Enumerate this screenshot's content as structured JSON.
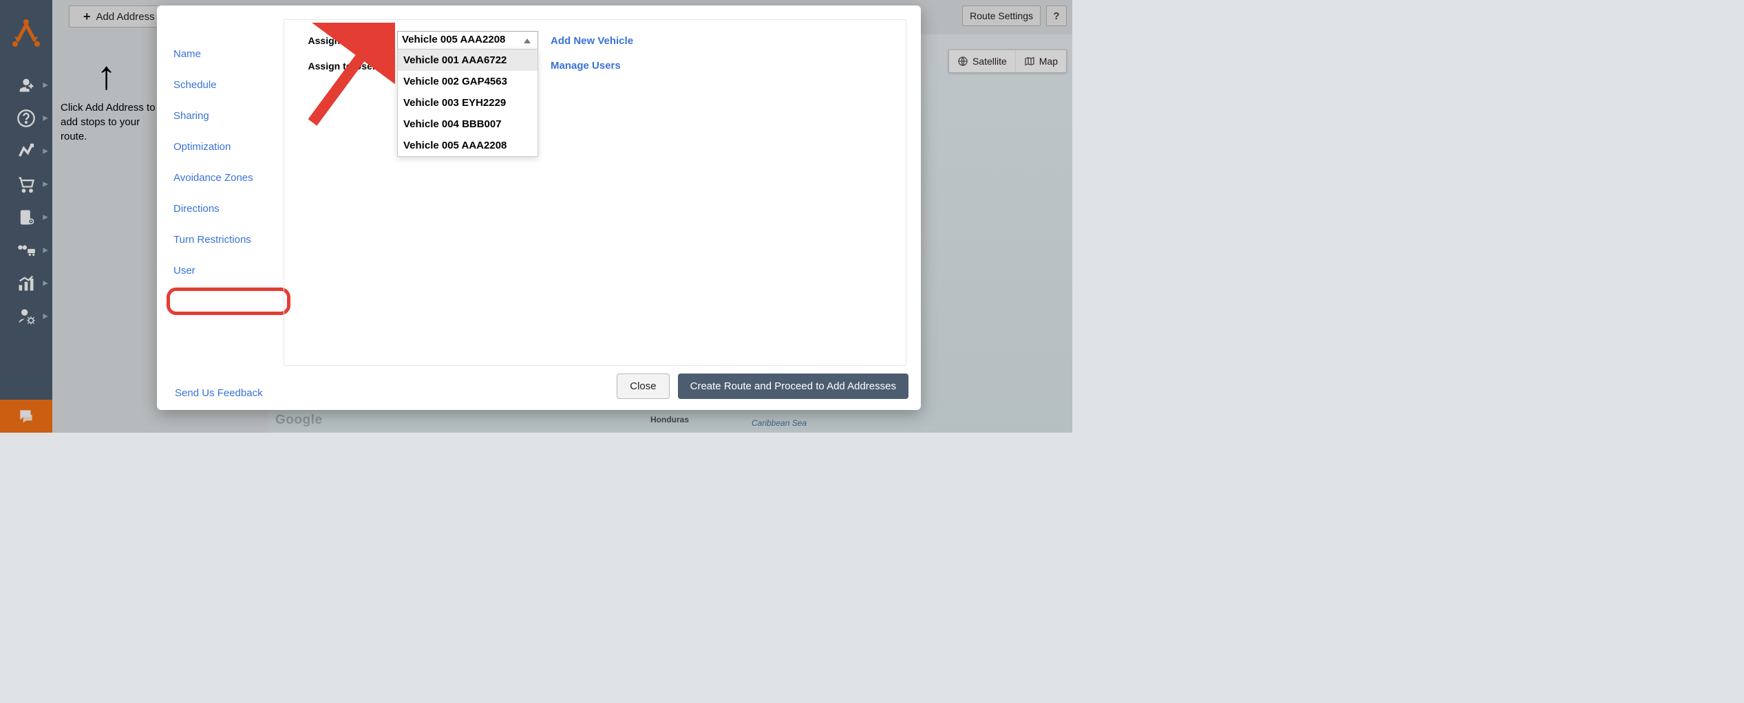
{
  "topbar": {
    "add_address_label": "Add Address",
    "route_settings_label": "Route Settings",
    "help_icon_label": "?"
  },
  "hint": {
    "text": "Click Add Address to add stops to your route."
  },
  "map_controls": {
    "satellite_label": "Satellite",
    "map_label": "Map"
  },
  "map": {
    "attribution": "Google",
    "label_honduras": "Honduras",
    "label_caribbean": "Caribbean Sea"
  },
  "modal": {
    "nav": {
      "name": "Name",
      "schedule": "Schedule",
      "sharing": "Sharing",
      "optimization": "Optimization",
      "avoidance_zones": "Avoidance Zones",
      "directions": "Directions",
      "turn_restrictions": "Turn Restrictions",
      "user": "User"
    },
    "feedback_label": "Send Us Feedback",
    "panel": {
      "assign_vehicle_label": "Assign Vehicle:",
      "assign_vehicle_value": "Vehicle 005 AAA2208",
      "vehicle_options": [
        "Vehicle 001 AAA6722",
        "Vehicle 002 GAP4563",
        "Vehicle 003 EYH2229",
        "Vehicle 004 BBB007",
        "Vehicle 005 AAA2208"
      ],
      "add_new_vehicle_label": "Add New Vehicle",
      "assign_user_label": "Assign to User:",
      "manage_users_label": "Manage Users"
    },
    "footer": {
      "close_label": "Close",
      "create_label": "Create Route and Proceed to Add Addresses"
    }
  }
}
